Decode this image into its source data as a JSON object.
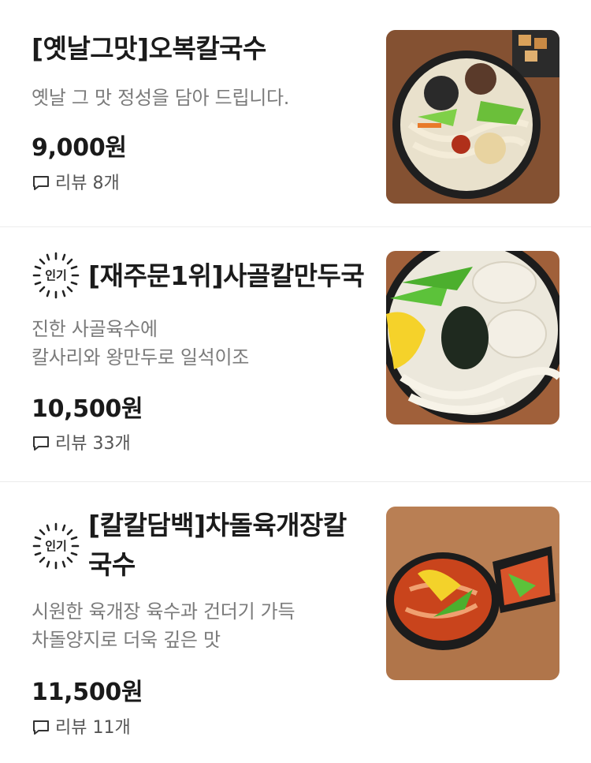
{
  "menu_items": [
    {
      "name": "[옛날그맛]오복칼국수",
      "description_lines": [
        "옛날 그 맛 정성을 담아 드립니다."
      ],
      "price": "9,000원",
      "review_label": "리뷰 8개",
      "popular": false,
      "photo": "kalguksu-bowl-photo"
    },
    {
      "badge": "인기",
      "name": "[재주문1위]사골칼만두국",
      "description_lines": [
        "진한 사골육수에",
        "칼사리와 왕만두로 일석이조"
      ],
      "price": "10,500원",
      "review_label": "리뷰 33개",
      "popular": true,
      "photo": "mandu-guk-bowl-photo"
    },
    {
      "badge": "인기",
      "name_lines": [
        "[칼칼담백]차돌육개장칼",
        "국수"
      ],
      "description_lines": [
        "시원한 육개장 육수과 건더기 가득",
        "차돌양지로 더욱 깊은 맛"
      ],
      "price": "11,500원",
      "review_label": "리뷰 11개",
      "popular": true,
      "photo": "yukgaejang-kalguksu-photo"
    }
  ],
  "colors": {
    "text_primary": "#1a1a1a",
    "text_secondary": "#7b7b7b",
    "divider": "#ececec",
    "background": "#ffffff"
  },
  "icons": {
    "review": "speech-bubble-icon",
    "popular": "sunburst-badge-icon"
  }
}
